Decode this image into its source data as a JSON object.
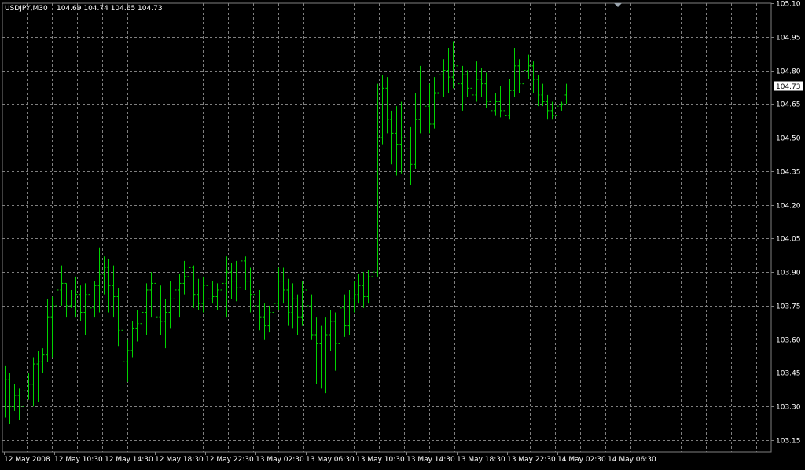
{
  "header": {
    "symbol_tf": "USDJPY,M30",
    "ohlc": "104.69 104.74 104.65 104.73"
  },
  "current_price_label": "104.73",
  "colors": {
    "background": "#000000",
    "grid": "#7f7f7f",
    "bars": "#00d400",
    "price_line": "#4b7a88",
    "period_separator": "#d08a78",
    "text": "#ffffff"
  },
  "chart_data": {
    "type": "ohlc_bar",
    "title": "USDJPY,M30",
    "y_ticks": [
      "105.10",
      "104.95",
      "104.80",
      "104.65",
      "104.50",
      "104.35",
      "104.20",
      "104.05",
      "103.90",
      "103.75",
      "103.60",
      "103.45",
      "103.30",
      "103.15"
    ],
    "ylim": [
      103.15,
      105.1
    ],
    "x_ticks": [
      "12 May 2008",
      "12 May 10:30",
      "12 May 14:30",
      "12 May 18:30",
      "12 May 22:30",
      "13 May 02:30",
      "13 May 06:30",
      "13 May 10:30",
      "13 May 14:30",
      "13 May 18:30",
      "13 May 22:30",
      "14 May 02:30",
      "14 May 06:30"
    ],
    "grid": true,
    "last_price": 104.73,
    "bars": [
      {
        "o": 103.45,
        "h": 103.48,
        "l": 103.25,
        "c": 103.42
      },
      {
        "o": 103.42,
        "h": 103.45,
        "l": 103.22,
        "c": 103.3
      },
      {
        "o": 103.3,
        "h": 103.4,
        "l": 103.28,
        "c": 103.35
      },
      {
        "o": 103.35,
        "h": 103.38,
        "l": 103.24,
        "c": 103.3
      },
      {
        "o": 103.3,
        "h": 103.4,
        "l": 103.27,
        "c": 103.37
      },
      {
        "o": 103.37,
        "h": 103.45,
        "l": 103.33,
        "c": 103.4
      },
      {
        "o": 103.4,
        "h": 103.52,
        "l": 103.3,
        "c": 103.49
      },
      {
        "o": 103.49,
        "h": 103.55,
        "l": 103.32,
        "c": 103.5
      },
      {
        "o": 103.5,
        "h": 103.56,
        "l": 103.45,
        "c": 103.53
      },
      {
        "o": 103.53,
        "h": 103.78,
        "l": 103.5,
        "c": 103.7
      },
      {
        "o": 103.7,
        "h": 103.79,
        "l": 103.52,
        "c": 103.75
      },
      {
        "o": 103.75,
        "h": 103.86,
        "l": 103.72,
        "c": 103.82
      },
      {
        "o": 103.82,
        "h": 103.93,
        "l": 103.75,
        "c": 103.85
      },
      {
        "o": 103.85,
        "h": 103.85,
        "l": 103.7,
        "c": 103.75
      },
      {
        "o": 103.75,
        "h": 103.82,
        "l": 103.74,
        "c": 103.78
      },
      {
        "o": 103.78,
        "h": 103.88,
        "l": 103.7,
        "c": 103.8
      },
      {
        "o": 103.8,
        "h": 103.84,
        "l": 103.68,
        "c": 103.72
      },
      {
        "o": 103.72,
        "h": 103.85,
        "l": 103.62,
        "c": 103.8
      },
      {
        "o": 103.8,
        "h": 103.9,
        "l": 103.65,
        "c": 103.74
      },
      {
        "o": 103.74,
        "h": 103.86,
        "l": 103.7,
        "c": 103.84
      },
      {
        "o": 103.84,
        "h": 104.01,
        "l": 103.72,
        "c": 103.89
      },
      {
        "o": 103.89,
        "h": 103.97,
        "l": 103.8,
        "c": 103.92
      },
      {
        "o": 103.92,
        "h": 103.96,
        "l": 103.72,
        "c": 103.84
      },
      {
        "o": 103.84,
        "h": 103.93,
        "l": 103.7,
        "c": 103.79
      },
      {
        "o": 103.79,
        "h": 103.83,
        "l": 103.57,
        "c": 103.64
      },
      {
        "o": 103.64,
        "h": 103.8,
        "l": 103.27,
        "c": 103.5
      },
      {
        "o": 103.5,
        "h": 103.6,
        "l": 103.41,
        "c": 103.55
      },
      {
        "o": 103.55,
        "h": 103.68,
        "l": 103.52,
        "c": 103.65
      },
      {
        "o": 103.65,
        "h": 103.73,
        "l": 103.59,
        "c": 103.67
      },
      {
        "o": 103.67,
        "h": 103.8,
        "l": 103.6,
        "c": 103.72
      },
      {
        "o": 103.72,
        "h": 103.85,
        "l": 103.62,
        "c": 103.82
      },
      {
        "o": 103.82,
        "h": 103.9,
        "l": 103.7,
        "c": 103.85
      },
      {
        "o": 103.85,
        "h": 103.88,
        "l": 103.64,
        "c": 103.7
      },
      {
        "o": 103.7,
        "h": 103.84,
        "l": 103.62,
        "c": 103.68
      },
      {
        "o": 103.68,
        "h": 103.78,
        "l": 103.56,
        "c": 103.72
      },
      {
        "o": 103.72,
        "h": 103.86,
        "l": 103.65,
        "c": 103.78
      },
      {
        "o": 103.78,
        "h": 103.86,
        "l": 103.6,
        "c": 103.82
      },
      {
        "o": 103.82,
        "h": 103.89,
        "l": 103.7,
        "c": 103.85
      },
      {
        "o": 103.85,
        "h": 103.95,
        "l": 103.8,
        "c": 103.88
      },
      {
        "o": 103.88,
        "h": 103.96,
        "l": 103.78,
        "c": 103.92
      },
      {
        "o": 103.92,
        "h": 103.93,
        "l": 103.74,
        "c": 103.8
      },
      {
        "o": 103.8,
        "h": 103.87,
        "l": 103.73,
        "c": 103.76
      },
      {
        "o": 103.76,
        "h": 103.88,
        "l": 103.72,
        "c": 103.84
      },
      {
        "o": 103.84,
        "h": 103.86,
        "l": 103.74,
        "c": 103.78
      },
      {
        "o": 103.78,
        "h": 103.86,
        "l": 103.76,
        "c": 103.79
      },
      {
        "o": 103.79,
        "h": 103.85,
        "l": 103.73,
        "c": 103.82
      },
      {
        "o": 103.82,
        "h": 103.9,
        "l": 103.75,
        "c": 103.85
      },
      {
        "o": 103.85,
        "h": 103.97,
        "l": 103.7,
        "c": 103.9
      },
      {
        "o": 103.9,
        "h": 103.94,
        "l": 103.78,
        "c": 103.86
      },
      {
        "o": 103.86,
        "h": 103.95,
        "l": 103.77,
        "c": 103.83
      },
      {
        "o": 103.83,
        "h": 103.99,
        "l": 103.78,
        "c": 103.95
      },
      {
        "o": 103.95,
        "h": 103.97,
        "l": 103.82,
        "c": 103.86
      },
      {
        "o": 103.86,
        "h": 103.92,
        "l": 103.72,
        "c": 103.8
      },
      {
        "o": 103.8,
        "h": 103.86,
        "l": 103.71,
        "c": 103.75
      },
      {
        "o": 103.75,
        "h": 103.82,
        "l": 103.64,
        "c": 103.7
      },
      {
        "o": 103.7,
        "h": 103.76,
        "l": 103.6,
        "c": 103.66
      },
      {
        "o": 103.66,
        "h": 103.75,
        "l": 103.63,
        "c": 103.72
      },
      {
        "o": 103.72,
        "h": 103.8,
        "l": 103.66,
        "c": 103.76
      },
      {
        "o": 103.76,
        "h": 103.92,
        "l": 103.73,
        "c": 103.86
      },
      {
        "o": 103.86,
        "h": 103.92,
        "l": 103.76,
        "c": 103.82
      },
      {
        "o": 103.82,
        "h": 103.87,
        "l": 103.66,
        "c": 103.72
      },
      {
        "o": 103.72,
        "h": 103.85,
        "l": 103.65,
        "c": 103.78
      },
      {
        "o": 103.78,
        "h": 103.8,
        "l": 103.62,
        "c": 103.7
      },
      {
        "o": 103.7,
        "h": 103.86,
        "l": 103.66,
        "c": 103.82
      },
      {
        "o": 103.82,
        "h": 103.88,
        "l": 103.72,
        "c": 103.75
      },
      {
        "o": 103.75,
        "h": 103.8,
        "l": 103.6,
        "c": 103.62
      },
      {
        "o": 103.62,
        "h": 103.7,
        "l": 103.4,
        "c": 103.58
      },
      {
        "o": 103.58,
        "h": 103.66,
        "l": 103.38,
        "c": 103.45
      },
      {
        "o": 103.45,
        "h": 103.7,
        "l": 103.36,
        "c": 103.62
      },
      {
        "o": 103.62,
        "h": 103.73,
        "l": 103.55,
        "c": 103.68
      },
      {
        "o": 103.68,
        "h": 103.72,
        "l": 103.46,
        "c": 103.58
      },
      {
        "o": 103.58,
        "h": 103.78,
        "l": 103.56,
        "c": 103.74
      },
      {
        "o": 103.74,
        "h": 103.8,
        "l": 103.61,
        "c": 103.66
      },
      {
        "o": 103.66,
        "h": 103.82,
        "l": 103.62,
        "c": 103.78
      },
      {
        "o": 103.78,
        "h": 103.86,
        "l": 103.72,
        "c": 103.8
      },
      {
        "o": 103.8,
        "h": 103.89,
        "l": 103.76,
        "c": 103.84
      },
      {
        "o": 103.84,
        "h": 103.9,
        "l": 103.74,
        "c": 103.79
      },
      {
        "o": 103.79,
        "h": 103.91,
        "l": 103.76,
        "c": 103.88
      },
      {
        "o": 103.88,
        "h": 103.91,
        "l": 103.84,
        "c": 103.9
      },
      {
        "o": 103.9,
        "h": 104.74,
        "l": 103.88,
        "c": 104.5
      },
      {
        "o": 104.5,
        "h": 104.78,
        "l": 104.47,
        "c": 104.72
      },
      {
        "o": 104.72,
        "h": 104.77,
        "l": 104.52,
        "c": 104.58
      },
      {
        "o": 104.58,
        "h": 104.62,
        "l": 104.38,
        "c": 104.52
      },
      {
        "o": 104.52,
        "h": 104.64,
        "l": 104.33,
        "c": 104.47
      },
      {
        "o": 104.47,
        "h": 104.66,
        "l": 104.34,
        "c": 104.5
      },
      {
        "o": 104.5,
        "h": 104.55,
        "l": 104.32,
        "c": 104.45
      },
      {
        "o": 104.45,
        "h": 104.55,
        "l": 104.29,
        "c": 104.38
      },
      {
        "o": 104.38,
        "h": 104.7,
        "l": 104.36,
        "c": 104.58
      },
      {
        "o": 104.58,
        "h": 104.82,
        "l": 104.52,
        "c": 104.73
      },
      {
        "o": 104.73,
        "h": 104.76,
        "l": 104.55,
        "c": 104.64
      },
      {
        "o": 104.64,
        "h": 104.74,
        "l": 104.52,
        "c": 104.56
      },
      {
        "o": 104.56,
        "h": 104.77,
        "l": 104.54,
        "c": 104.7
      },
      {
        "o": 104.7,
        "h": 104.84,
        "l": 104.62,
        "c": 104.78
      },
      {
        "o": 104.78,
        "h": 104.85,
        "l": 104.68,
        "c": 104.8
      },
      {
        "o": 104.8,
        "h": 104.9,
        "l": 104.7,
        "c": 104.77
      },
      {
        "o": 104.77,
        "h": 104.93,
        "l": 104.72,
        "c": 104.82
      },
      {
        "o": 104.82,
        "h": 104.83,
        "l": 104.66,
        "c": 104.74
      },
      {
        "o": 104.74,
        "h": 104.82,
        "l": 104.62,
        "c": 104.78
      },
      {
        "o": 104.78,
        "h": 104.8,
        "l": 104.68,
        "c": 104.72
      },
      {
        "o": 104.72,
        "h": 104.78,
        "l": 104.65,
        "c": 104.69
      },
      {
        "o": 104.69,
        "h": 104.84,
        "l": 104.66,
        "c": 104.76
      },
      {
        "o": 104.76,
        "h": 104.81,
        "l": 104.68,
        "c": 104.74
      },
      {
        "o": 104.74,
        "h": 104.79,
        "l": 104.63,
        "c": 104.66
      },
      {
        "o": 104.66,
        "h": 104.72,
        "l": 104.6,
        "c": 104.62
      },
      {
        "o": 104.62,
        "h": 104.7,
        "l": 104.6,
        "c": 104.66
      },
      {
        "o": 104.66,
        "h": 104.73,
        "l": 104.59,
        "c": 104.62
      },
      {
        "o": 104.62,
        "h": 104.66,
        "l": 104.57,
        "c": 104.6
      },
      {
        "o": 104.6,
        "h": 104.76,
        "l": 104.58,
        "c": 104.71
      },
      {
        "o": 104.71,
        "h": 104.9,
        "l": 104.68,
        "c": 104.82
      },
      {
        "o": 104.82,
        "h": 104.85,
        "l": 104.7,
        "c": 104.74
      },
      {
        "o": 104.74,
        "h": 104.84,
        "l": 104.72,
        "c": 104.8
      },
      {
        "o": 104.8,
        "h": 104.87,
        "l": 104.76,
        "c": 104.82
      },
      {
        "o": 104.82,
        "h": 104.84,
        "l": 104.7,
        "c": 104.76
      },
      {
        "o": 104.76,
        "h": 104.78,
        "l": 104.64,
        "c": 104.69
      },
      {
        "o": 104.69,
        "h": 104.74,
        "l": 104.64,
        "c": 104.66
      },
      {
        "o": 104.66,
        "h": 104.69,
        "l": 104.58,
        "c": 104.62
      },
      {
        "o": 104.62,
        "h": 104.66,
        "l": 104.58,
        "c": 104.6
      },
      {
        "o": 104.6,
        "h": 104.67,
        "l": 104.6,
        "c": 104.64
      },
      {
        "o": 104.64,
        "h": 104.66,
        "l": 104.62,
        "c": 104.65
      },
      {
        "o": 104.69,
        "h": 104.74,
        "l": 104.65,
        "c": 104.73
      }
    ]
  }
}
